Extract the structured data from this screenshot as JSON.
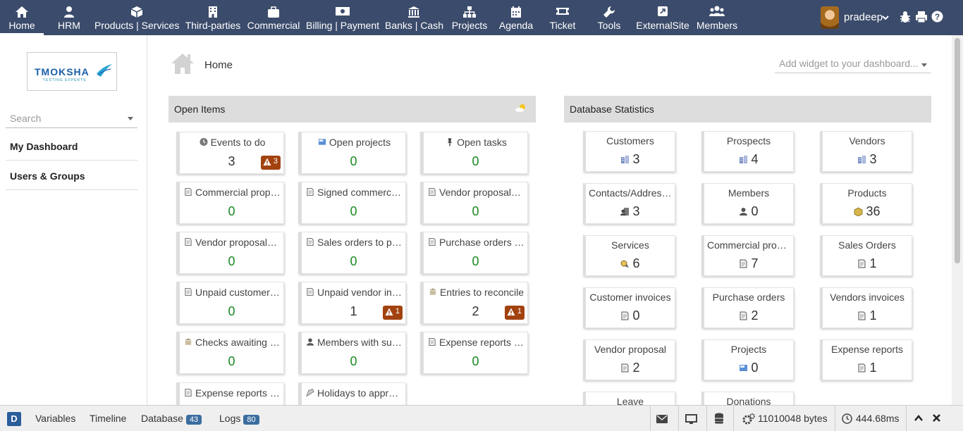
{
  "nav": {
    "items": [
      {
        "label": "Home",
        "icon": "home-icon"
      },
      {
        "label": "HRM",
        "icon": "user-icon"
      },
      {
        "label": "Products | Services",
        "icon": "cube-icon"
      },
      {
        "label": "Third-parties",
        "icon": "building-icon"
      },
      {
        "label": "Commercial",
        "icon": "suitcase-icon"
      },
      {
        "label": "Billing | Payment",
        "icon": "money-icon"
      },
      {
        "label": "Banks | Cash",
        "icon": "bank-icon"
      },
      {
        "label": "Projects",
        "icon": "sitemap-icon"
      },
      {
        "label": "Agenda",
        "icon": "calendar-icon"
      },
      {
        "label": "Ticket",
        "icon": "ticket-icon"
      },
      {
        "label": "Tools",
        "icon": "wrench-icon"
      },
      {
        "label": "ExternalSite",
        "icon": "external-link-icon"
      },
      {
        "label": "Members",
        "icon": "users-icon"
      }
    ],
    "user": "pradeep"
  },
  "sidebar": {
    "search_placeholder": "Search",
    "items": [
      {
        "label": "My Dashboard"
      },
      {
        "label": "Users & Groups"
      }
    ],
    "logo_text": "TMOKSHA",
    "logo_sub": "TESTING EXPERTS"
  },
  "page": {
    "title": "Home",
    "add_widget": "Add widget to your dashboard..."
  },
  "open_items": {
    "title": "Open Items",
    "boxes": [
      {
        "label": "Events to do",
        "value": "3",
        "warning": "3"
      },
      {
        "label": "Open projects",
        "value": "0"
      },
      {
        "label": "Open tasks",
        "value": "0"
      },
      {
        "label": "Commercial proposals to be signed",
        "value": "0"
      },
      {
        "label": "Signed commercial proposals to bill",
        "value": "0"
      },
      {
        "label": "Vendor proposals to process",
        "value": "0"
      },
      {
        "label": "Vendor proposals to close",
        "value": "0"
      },
      {
        "label": "Sales orders to process",
        "value": "0"
      },
      {
        "label": "Purchase orders to process",
        "value": "0"
      },
      {
        "label": "Unpaid customer invoices",
        "value": "0"
      },
      {
        "label": "Unpaid vendor invoices",
        "value": "1",
        "warning": "1"
      },
      {
        "label": "Entries to reconcile",
        "value": "2",
        "warning": "1"
      },
      {
        "label": "Checks awaiting deposit",
        "value": "0"
      },
      {
        "label": "Members with subscription to renew",
        "value": "0"
      },
      {
        "label": "Expense reports to approve",
        "value": "0"
      },
      {
        "label": "Expense reports to pay",
        "value": ""
      },
      {
        "label": "Holidays to approve",
        "value": ""
      }
    ]
  },
  "stats": {
    "title": "Database Statistics",
    "boxes": [
      {
        "label": "Customers",
        "value": "3"
      },
      {
        "label": "Prospects",
        "value": "4"
      },
      {
        "label": "Vendors",
        "value": "3"
      },
      {
        "label": "Contacts/Addresses",
        "value": "3"
      },
      {
        "label": "Members",
        "value": "0"
      },
      {
        "label": "Products",
        "value": "36"
      },
      {
        "label": "Services",
        "value": "6"
      },
      {
        "label": "Commercial proposals",
        "value": "7"
      },
      {
        "label": "Sales Orders",
        "value": "1"
      },
      {
        "label": "Customer invoices",
        "value": "0"
      },
      {
        "label": "Purchase orders",
        "value": "2"
      },
      {
        "label": "Vendors invoices",
        "value": "1"
      },
      {
        "label": "Vendor proposal",
        "value": "2"
      },
      {
        "label": "Projects",
        "value": "0"
      },
      {
        "label": "Expense reports",
        "value": "1"
      },
      {
        "label": "Leave",
        "value": ""
      },
      {
        "label": "Donations",
        "value": ""
      }
    ]
  },
  "debugbar": {
    "logo": "D",
    "variables": "Variables",
    "timeline": "Timeline",
    "database": "Database",
    "database_count": "43",
    "logs": "Logs",
    "logs_count": "80",
    "memory": "11010048 bytes",
    "time": "444.68ms"
  },
  "colors": {
    "topbar": "#3b4b6b",
    "zero_value": "#1a8a22",
    "warning": "#a2420f"
  }
}
